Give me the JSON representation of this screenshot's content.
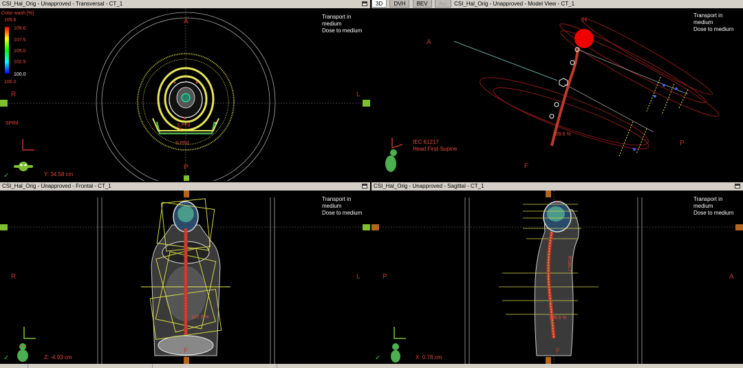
{
  "panes": {
    "transversal": {
      "title": "CSI_Hal_Orig - Unapproved - Transversal - CT_1",
      "info": "Transport in\nmedium\nDose to medium",
      "coord": "Y: 34.58 cm",
      "orient": {
        "top": "A",
        "bottom": "P",
        "left": "R",
        "right": "L"
      },
      "colorwash": {
        "title": "Color wash [%]",
        "max": "109.6",
        "ticks": [
          "109.6",
          "107.5",
          "105.0",
          "102.5"
        ],
        "min_handle": "100.0",
        "min": "100.0"
      },
      "structure_labels": [
        "SPRd",
        "S.PFd",
        "S.PFd"
      ]
    },
    "model": {
      "tabs": [
        {
          "label": "3D",
          "active": true
        },
        {
          "label": "DVH",
          "active": false
        },
        {
          "label": "BEV",
          "active": false
        },
        {
          "label": "Arc",
          "active": false,
          "disabled": true
        }
      ],
      "title": "CSI_Hal_Orig - Unapproved - Model View - CT_1",
      "info": "Transport in\nmedium\nDose to medium",
      "orient": {
        "head": "H",
        "anterior": "A",
        "posterior": "P",
        "feet": "F"
      },
      "iec": "IEC 61217\nHead First-Supine",
      "dose_label": "109.6 %"
    },
    "frontal": {
      "title": "CSI_Hal_Orig - Unapproved - Frontal - CT_1",
      "info": "Transport in\nmedium\nDose to medium",
      "coord": "Z: -4.93 cm",
      "orient": {
        "left": "R",
        "right": "L",
        "bottom": "F"
      },
      "dose_label": "107.0 %"
    },
    "sagittal": {
      "title": "CSI_Hal_Orig - Unapproved - Sagittal - CT_1",
      "info": "Transport in\nmedium\nDose to medium",
      "coord": "X: 0.78 cm",
      "orient": {
        "left": "P",
        "right": "A",
        "top": "H",
        "bottom": "F"
      },
      "dose_label": "108.6 %",
      "vertical_label": "RSBCT"
    }
  },
  "colors": {
    "dose_red": "#c0392b",
    "field_yellow": "#e6e65a",
    "crosshair_green": "#7fbf2f",
    "marker_orange": "#b5651d"
  },
  "check_mark": "✓"
}
